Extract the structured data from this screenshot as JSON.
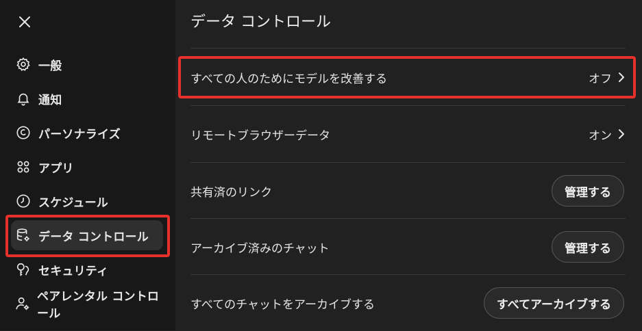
{
  "sidebar": {
    "close_icon": "close-icon",
    "items": [
      {
        "label": "一般",
        "icon": "gear-icon"
      },
      {
        "label": "通知",
        "icon": "bell-icon"
      },
      {
        "label": "パーソナライズ",
        "icon": "personalize-icon"
      },
      {
        "label": "アプリ",
        "icon": "apps-grid-icon"
      },
      {
        "label": "スケジュール",
        "icon": "clock-icon"
      },
      {
        "label": "データ コントロール",
        "icon": "database-gear-icon",
        "active": true
      },
      {
        "label": "セキュリティ",
        "icon": "key-lock-icon"
      },
      {
        "label": "ペアレンタル コントロール",
        "icon": "parental-user-icon"
      }
    ]
  },
  "main": {
    "title": "データ コントロール",
    "rows": [
      {
        "label": "すべての人のためにモデルを改善する",
        "value": "オフ"
      },
      {
        "label": "リモートブラウザーデータ",
        "value": "オン"
      },
      {
        "label": "共有済のリンク",
        "button": "管理する"
      },
      {
        "label": "アーカイブ済みのチャット",
        "button": "管理する"
      },
      {
        "label": "すべてのチャットをアーカイブする",
        "button": "すべてアーカイブする"
      }
    ]
  },
  "colors": {
    "background": "#212121",
    "sidebar": "#181818",
    "highlight": "#e5302c"
  }
}
